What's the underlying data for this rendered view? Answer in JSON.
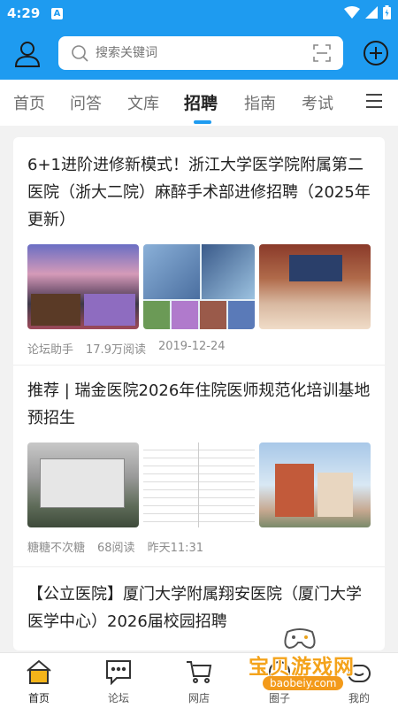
{
  "status": {
    "time": "4:29",
    "notif_letter": "A"
  },
  "search": {
    "placeholder": "搜索关键词"
  },
  "tabs": [
    {
      "label": "首页"
    },
    {
      "label": "问答"
    },
    {
      "label": "文库"
    },
    {
      "label": "招聘",
      "active": true
    },
    {
      "label": "指南"
    },
    {
      "label": "考试"
    }
  ],
  "articles": [
    {
      "title": "6+1进阶进修新模式！浙江大学医学院附属第二医院（浙大二院）麻醉手术部进修招聘（2025年更新）",
      "author": "论坛助手",
      "reads": "17.9万阅读",
      "date": "2019-12-24"
    },
    {
      "title": "推荐 | 瑞金医院2026年住院医师规范化培训基地预招生",
      "author": "糖糖不次糖",
      "reads": "68阅读",
      "date": "昨天11:31"
    },
    {
      "title": "【公立医院】厦门大学附属翔安医院（厦门大学医学中心）2026届校园招聘"
    }
  ],
  "bottom_nav": [
    {
      "label": "首页",
      "icon": "home-icon",
      "active": true
    },
    {
      "label": "论坛",
      "icon": "forum-icon"
    },
    {
      "label": "网店",
      "icon": "cart-icon"
    },
    {
      "label": "圈子",
      "icon": "circle-icon"
    },
    {
      "label": "我的",
      "icon": "profile-icon"
    }
  ],
  "watermark": {
    "text": "宝贝游戏网",
    "url": "baobeiy.com"
  },
  "colors": {
    "primary": "#1e9bf0",
    "watermark": "#f4a31b"
  }
}
